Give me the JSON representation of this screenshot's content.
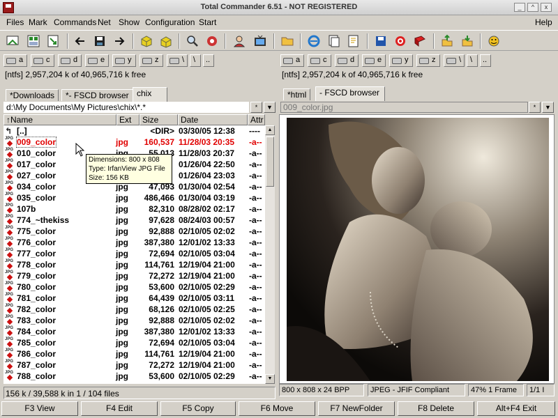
{
  "window": {
    "title": "Total Commander 6.51 - NOT REGISTERED",
    "min": "_",
    "max": "^",
    "close": "x"
  },
  "menu": [
    "Files",
    "Mark",
    "Commands",
    "Net",
    "Show",
    "Configuration",
    "Start",
    "Help"
  ],
  "toolbar_icons": [
    "refresh-icon",
    "thumbnail-view-icon",
    "file-tree-icon",
    "back-icon",
    "save-icon",
    "forward-icon",
    "pack-icon",
    "unpack-icon",
    "find-icon",
    "multi-rename-icon",
    "user-icon",
    "tv-icon",
    "folder-open-icon",
    "ie-icon",
    "copy-names-icon",
    "edit-icon",
    "save-settings-icon",
    "target-icon",
    "book-icon",
    "upload-icon",
    "download-icon",
    "smiley-icon"
  ],
  "left_drives": [
    "a",
    "c",
    "d",
    "e",
    "y",
    "z",
    "\\",
    "\\",
    ".."
  ],
  "right_drives": [
    "a",
    "c",
    "d",
    "e",
    "y",
    "z",
    "\\",
    "\\",
    ".."
  ],
  "left_free": "[ntfs]  2,957,204 k of 40,965,716 k free",
  "right_free": "[ntfs]  2,957,204 k of 40,965,716 k free",
  "left_tabs": [
    "*Downloads",
    "*- FSCD browser",
    "chix"
  ],
  "right_tabs": [
    "*html",
    "- FSCD browser"
  ],
  "left_path": "d:\\My Documents\\My Pictures\\chix\\*.*",
  "right_path": "009_color.jpg",
  "path_btn_star": "*",
  "path_btn_down": "▼",
  "columns": {
    "name": "↑Name",
    "ext": "Ext",
    "size": "Size",
    "date": "Date",
    "attr": "Attr"
  },
  "icon_label": "JPG",
  "files": [
    {
      "name": "[..]",
      "ext": "",
      "size": "<DIR>",
      "date": "03/30/05 12:38",
      "attr": "----"
    },
    {
      "name": "009_color",
      "ext": "jpg",
      "size": "160,537",
      "date": "11/28/03 20:35",
      "attr": "-a--"
    },
    {
      "name": "010_color",
      "ext": "jpg",
      "size": "55,013",
      "date": "11/28/03 20:37",
      "attr": "-a--"
    },
    {
      "name": "017_color",
      "ext": "jpg",
      "size": "",
      "date": "01/26/04 22:50",
      "attr": "-a--"
    },
    {
      "name": "027_color",
      "ext": "jpg",
      "size": "",
      "date": "01/26/04 23:03",
      "attr": "-a--"
    },
    {
      "name": "034_color",
      "ext": "jpg",
      "size": "47,093",
      "date": "01/30/04 02:54",
      "attr": "-a--"
    },
    {
      "name": "035_color",
      "ext": "jpg",
      "size": "486,466",
      "date": "01/30/04 03:19",
      "attr": "-a--"
    },
    {
      "name": "107b",
      "ext": "jpg",
      "size": "82,310",
      "date": "08/28/02 02:17",
      "attr": "-a--"
    },
    {
      "name": "774_~thekiss",
      "ext": "jpg",
      "size": "97,628",
      "date": "08/24/03 00:57",
      "attr": "-a--"
    },
    {
      "name": "775_color",
      "ext": "jpg",
      "size": "92,888",
      "date": "02/10/05 02:02",
      "attr": "-a--"
    },
    {
      "name": "776_color",
      "ext": "jpg",
      "size": "387,380",
      "date": "12/01/02 13:33",
      "attr": "-a--"
    },
    {
      "name": "777_color",
      "ext": "jpg",
      "size": "72,694",
      "date": "02/10/05 03:04",
      "attr": "-a--"
    },
    {
      "name": "778_color",
      "ext": "jpg",
      "size": "114,761",
      "date": "12/19/04 21:00",
      "attr": "-a--"
    },
    {
      "name": "779_color",
      "ext": "jpg",
      "size": "72,272",
      "date": "12/19/04 21:00",
      "attr": "-a--"
    },
    {
      "name": "780_color",
      "ext": "jpg",
      "size": "53,600",
      "date": "02/10/05 02:29",
      "attr": "-a--"
    },
    {
      "name": "781_color",
      "ext": "jpg",
      "size": "64,439",
      "date": "02/10/05 03:11",
      "attr": "-a--"
    },
    {
      "name": "782_color",
      "ext": "jpg",
      "size": "68,126",
      "date": "02/10/05 02:25",
      "attr": "-a--"
    },
    {
      "name": "783_color",
      "ext": "jpg",
      "size": "92,888",
      "date": "02/10/05 02:02",
      "attr": "-a--"
    },
    {
      "name": "784_color",
      "ext": "jpg",
      "size": "387,380",
      "date": "12/01/02 13:33",
      "attr": "-a--"
    },
    {
      "name": "785_color",
      "ext": "jpg",
      "size": "72,694",
      "date": "02/10/05 03:04",
      "attr": "-a--"
    },
    {
      "name": "786_color",
      "ext": "jpg",
      "size": "114,761",
      "date": "12/19/04 21:00",
      "attr": "-a--"
    },
    {
      "name": "787_color",
      "ext": "jpg",
      "size": "72,272",
      "date": "12/19/04 21:00",
      "attr": "-a--"
    },
    {
      "name": "788_color",
      "ext": "jpg",
      "size": "53,600",
      "date": "02/10/05 02:29",
      "attr": "-a--"
    }
  ],
  "tooltip": {
    "dimensions": "Dimensions: 800 x 808",
    "type": "Type: IrfanView JPG File",
    "size": "Size: 156 KB"
  },
  "left_status": "156 k / 39,588 k in 1 / 104 files",
  "viewer_status": {
    "dims": "800 x 808 x 24 BPP",
    "format": "JPEG - JFIF Compliant",
    "zoom": "47%  1 Frame",
    "page": "1/1 I"
  },
  "fkeys": [
    "F3 View",
    "F4 Edit",
    "F5 Copy",
    "F6 Move",
    "F7 NewFolder",
    "F8 Delete",
    "Alt+F4 Exit"
  ],
  "colors": {
    "cursor_file": "#e00000",
    "app_icon": "#9b1b1b",
    "tooltip_bg": "#ffffe1"
  }
}
